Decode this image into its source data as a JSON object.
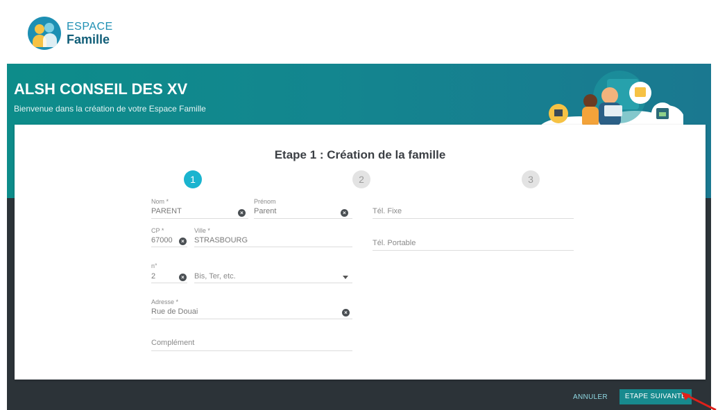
{
  "logo": {
    "line1": "ESPACE",
    "line2": "Famille"
  },
  "banner": {
    "title": "ALSH CONSEIL DES XV",
    "subtitle": "Bienvenue dans la création de votre Espace Famille"
  },
  "wizard": {
    "title": "Etape 1 : Création de la famille",
    "steps": [
      "1",
      "2",
      "3"
    ],
    "active_step": 1
  },
  "form": {
    "nom": {
      "label": "Nom *",
      "value": "PARENT"
    },
    "prenom": {
      "label": "Prénom",
      "value": "Parent"
    },
    "tel_fixe": {
      "placeholder": "Tél. Fixe"
    },
    "cp": {
      "label": "CP *",
      "value": "67000"
    },
    "ville": {
      "label": "Ville *",
      "value": "STRASBOURG"
    },
    "tel_portable": {
      "placeholder": "Tél. Portable"
    },
    "numero": {
      "label": "n°",
      "value": "2"
    },
    "bis": {
      "placeholder": "Bis, Ter, etc."
    },
    "adresse": {
      "label": "Adresse *",
      "value": "Rue de Douai"
    },
    "complement": {
      "placeholder": "Complément"
    }
  },
  "footer": {
    "cancel_label": "ANNULER",
    "next_label": "ETAPE SUIVANTE"
  },
  "colors": {
    "teal": "#0d8c8a",
    "step_active": "#1ab4cf",
    "dark_bg": "#2c3338",
    "next_button": "#178a8e"
  }
}
